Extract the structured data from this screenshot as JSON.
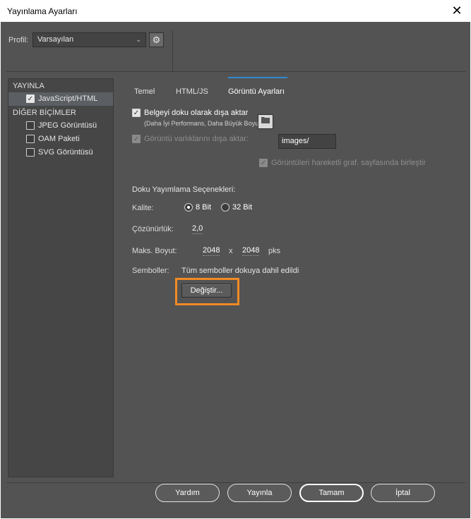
{
  "window": {
    "title": "Yayınlama Ayarları",
    "close_glyph": "✕"
  },
  "profile": {
    "label": "Profil:",
    "value": "Varsayılan",
    "dropdown_glyph": "⌄",
    "settings_glyph": "⚙"
  },
  "left_panel": {
    "publish_header": "YAYINLA",
    "publish_items": [
      {
        "label": "JavaScript/HTML",
        "checked": true
      }
    ],
    "other_header": "DİĞER BİÇİMLER",
    "other_items": [
      {
        "label": "JPEG Görüntüsü",
        "checked": false
      },
      {
        "label": "OAM Paketi",
        "checked": false
      },
      {
        "label": "SVG Görüntüsü",
        "checked": false
      }
    ]
  },
  "tabs": [
    {
      "label": "Temel"
    },
    {
      "label": "HTML/JS"
    },
    {
      "label": "Görüntü Ayarları",
      "active": true
    }
  ],
  "image_settings": {
    "export_doc_label": "Belgeyi doku olarak dışa aktar",
    "export_doc_hint": "(Daha İyi Performans, Daha Büyük Boyut)",
    "export_assets_label": "Görüntü varlıklarını dışa aktar:",
    "assets_path": "images/",
    "merge_label": "Görüntüleri hareketli graf. sayfasında birleştir",
    "section_title": "Doku Yayımlama Seçenekleri:",
    "quality_label": "Kalite:",
    "quality_options": [
      {
        "label": "8 Bit",
        "selected": true
      },
      {
        "label": "32 Bit",
        "selected": false
      }
    ],
    "resolution_label": "Çözünürlük:",
    "resolution_value": "2,0",
    "max_size_label": "Maks. Boyut:",
    "max_width": "2048",
    "size_separator": "x",
    "max_height": "2048",
    "size_unit": "pks",
    "symbols_label": "Semboller:",
    "symbols_value": "Tüm semboller dokuya dahil edildi",
    "change_button": "Değiştir..."
  },
  "footer": {
    "help": "Yardım",
    "publish": "Yayınla",
    "ok": "Tamam",
    "cancel": "İptal"
  },
  "colors": {
    "background": "#535353",
    "accent_tab": "#2f8ad1",
    "highlight": "#f08a24"
  },
  "icons": {
    "folder": "folder-icon",
    "gear": "gear-icon",
    "checkbox_check": "✓"
  }
}
